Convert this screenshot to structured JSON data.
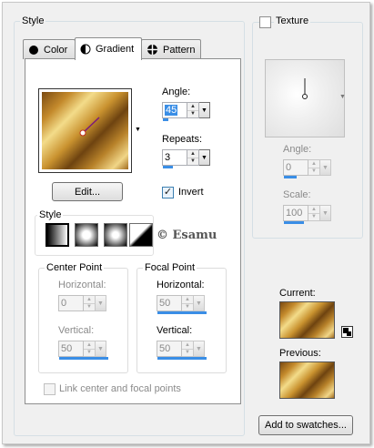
{
  "style_group": {
    "title": "Style",
    "tabs": [
      {
        "label": "Color",
        "icon": "color-circle-icon"
      },
      {
        "label": "Gradient",
        "icon": "gradient-half-icon"
      },
      {
        "label": "Pattern",
        "icon": "pattern-grid-icon"
      }
    ],
    "active_tab": "Gradient"
  },
  "gradient": {
    "angle_label": "Angle:",
    "angle_value": "45",
    "repeats_label": "Repeats:",
    "repeats_value": "3",
    "edit_button": "Edit...",
    "invert_label": "Invert",
    "invert_checked": true,
    "style_label": "Style",
    "watermark": "© Esamu",
    "style_buttons": [
      "linear-style",
      "rectangular-style",
      "sunburst-style",
      "radial-style"
    ],
    "center_point": {
      "title": "Center Point",
      "horizontal_label": "Horizontal:",
      "horizontal_value": "0",
      "vertical_label": "Vertical:",
      "vertical_value": "50"
    },
    "focal_point": {
      "title": "Focal Point",
      "horizontal_label": "Horizontal:",
      "horizontal_value": "50",
      "vertical_label": "Vertical:",
      "vertical_value": "50"
    },
    "link_label": "Link center and focal points",
    "link_checked": false
  },
  "texture": {
    "title": "Texture",
    "checked": false,
    "angle_label": "Angle:",
    "angle_value": "0",
    "scale_label": "Scale:",
    "scale_value": "100"
  },
  "swatches": {
    "current_label": "Current:",
    "previous_label": "Previous:",
    "add_button": "Add to swatches..."
  },
  "colors": {
    "accent_blue": "#3a8ee6",
    "gold_light": "#f3dc8a",
    "gold_dark": "#6e4310"
  }
}
